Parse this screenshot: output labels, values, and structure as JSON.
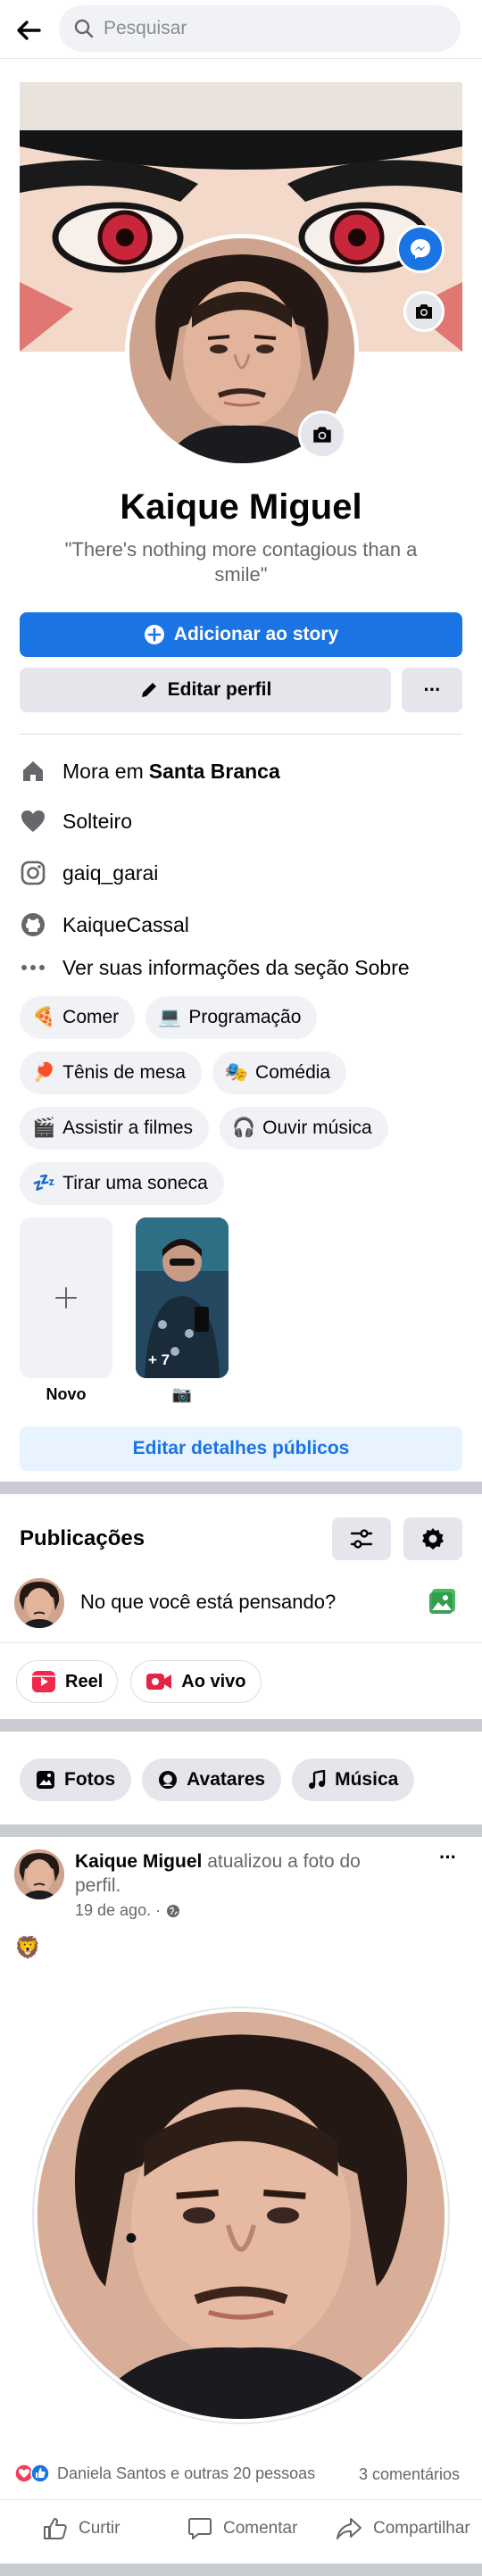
{
  "search": {
    "placeholder": "Pesquisar"
  },
  "profile": {
    "name": "Kaique Miguel",
    "bio": "\"There's nothing more contagious than a smile\""
  },
  "buttons": {
    "add_story": "Adicionar ao story",
    "edit_profile": "Editar perfil",
    "more": "···",
    "edit_public_details": "Editar detalhes públicos"
  },
  "details": {
    "lives_in_prefix": "Mora em",
    "lives_in_place": "Santa Branca",
    "relationship": "Solteiro",
    "instagram": "gaiq_garai",
    "github": "KaiqueCassal",
    "about": "Ver suas informações da seção Sobre"
  },
  "hobbies": [
    {
      "emoji": "🍕",
      "label": "Comer"
    },
    {
      "emoji": "💻",
      "label": "Programação"
    },
    {
      "emoji": "🏓",
      "label": "Tênis de mesa"
    },
    {
      "emoji": "🎭",
      "label": "Comédia"
    },
    {
      "emoji": "🎬",
      "label": "Assistir a filmes"
    },
    {
      "emoji": "🎧",
      "label": "Ouvir música"
    },
    {
      "emoji": "💤",
      "label": "Tirar uma soneca"
    }
  ],
  "featured": {
    "new_label": "Novo",
    "item_count": "+ 7",
    "item_label": "📷"
  },
  "posts": {
    "title": "Publicações",
    "composer_placeholder": "No que você está pensando?",
    "reel": "Reel",
    "live": "Ao vivo",
    "tabs": [
      "Fotos",
      "Avatares",
      "Música"
    ]
  },
  "post": {
    "author": "Kaique Miguel",
    "action": "atualizou a foto do perfil.",
    "date": "19 de ago. ·",
    "caption_emoji": "🦁",
    "reactions_text": "Daniela Santos e outras 20 pessoas",
    "comments_count": "3 comentários",
    "like": "Curtir",
    "comment": "Comentar",
    "share": "Compartilhar"
  },
  "colors": {
    "accent": "#1b74e4",
    "surface": "#f0f2f5",
    "secondary_text": "#65676b"
  }
}
